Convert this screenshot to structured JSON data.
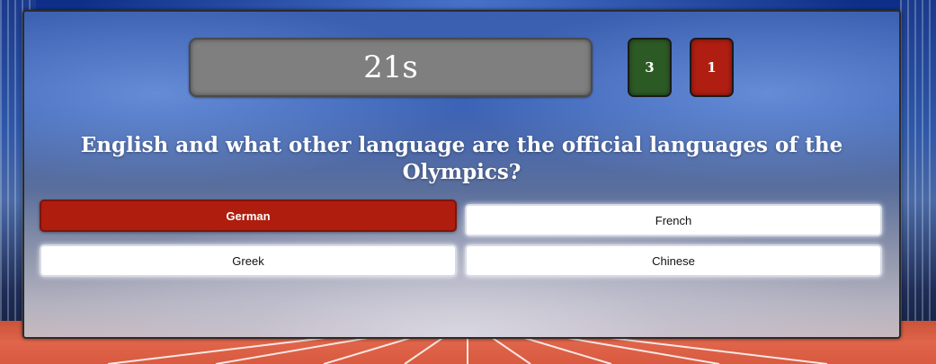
{
  "timer": {
    "text": "21s"
  },
  "scores": {
    "correct": "3",
    "wrong": "1"
  },
  "question": {
    "text": "English and what other language are the official languages of the Olympics?"
  },
  "answers": [
    {
      "label": "German",
      "state": "selected-wrong"
    },
    {
      "label": "French",
      "state": "default"
    },
    {
      "label": "Greek",
      "state": "default"
    },
    {
      "label": "Chinese",
      "state": "default"
    }
  ],
  "colors": {
    "correct_badge": "#2c5a25",
    "wrong_badge": "#b01e12",
    "selected_answer": "#ae1d0e",
    "timer_bg": "#7f7f7f"
  }
}
